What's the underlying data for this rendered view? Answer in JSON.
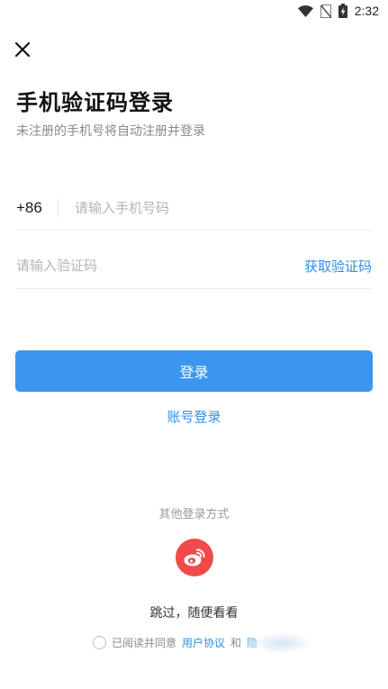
{
  "status_bar": {
    "time": "2:32",
    "icons": [
      "wifi-icon",
      "no-sim-icon",
      "battery-charging-icon"
    ]
  },
  "header": {
    "close_icon": "close-icon",
    "title": "手机验证码登录",
    "subtitle": "未注册的手机号将自动注册并登录"
  },
  "form": {
    "country_code": "+86",
    "phone_placeholder": "请输入手机号码",
    "code_placeholder": "请输入验证码",
    "get_code_label": "获取验证码",
    "login_label": "登录",
    "account_login_label": "账号登录"
  },
  "other_login": {
    "title": "其他登录方式",
    "icons": [
      "weibo-icon"
    ]
  },
  "skip_label": "跳过，随便看看",
  "agreement": {
    "prefix": "已阅读并同意",
    "user_agreement": "用户协议",
    "conjunction": "和",
    "privacy_partial": "隐"
  },
  "colors": {
    "accent": "#2f8ee8",
    "button": "#3a96ef",
    "weibo": "#f04a4a"
  }
}
